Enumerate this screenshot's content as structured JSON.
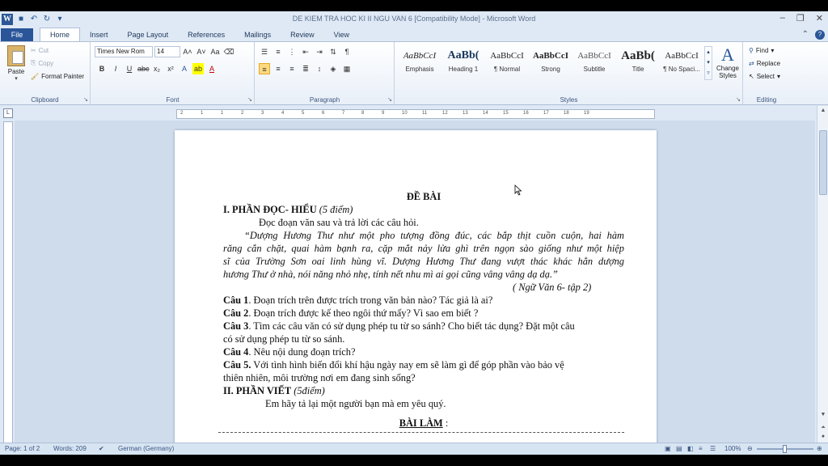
{
  "window": {
    "title": "DE KIEM TRA HOC KI II NGU VAN 6 [Compatibility Mode]  -  Microsoft Word",
    "app_icon": "W"
  },
  "tabs": {
    "file": "File",
    "items": [
      "Home",
      "Insert",
      "Page Layout",
      "References",
      "Mailings",
      "Review",
      "View"
    ]
  },
  "clipboard": {
    "label": "Clipboard",
    "paste": "Paste",
    "cut": "Cut",
    "copy": "Copy",
    "format_painter": "Format Painter"
  },
  "font": {
    "label": "Font",
    "family": "Times New Rom",
    "size": "14"
  },
  "paragraph": {
    "label": "Paragraph"
  },
  "styles": {
    "label": "Styles",
    "items": [
      {
        "sample": "AaBbCcI",
        "name": "Emphasis"
      },
      {
        "sample": "AaBb(",
        "name": "Heading 1"
      },
      {
        "sample": "AaBbCcI",
        "name": "¶ Normal"
      },
      {
        "sample": "AaBbCcI",
        "name": "Strong"
      },
      {
        "sample": "AaBbCcI",
        "name": "Subtitle"
      },
      {
        "sample": "AaBb(",
        "name": "Title"
      },
      {
        "sample": "AaBbCcI",
        "name": "¶ No Spaci..."
      }
    ],
    "change_styles": "Change Styles"
  },
  "editing": {
    "label": "Editing",
    "find": "Find",
    "replace": "Replace",
    "select": "Select"
  },
  "ruler": {
    "numbers": [
      "2",
      "1",
      "1",
      "2",
      "3",
      "4",
      "5",
      "6",
      "7",
      "8",
      "9",
      "10",
      "11",
      "12",
      "13",
      "14",
      "15",
      "16",
      "17",
      "18",
      "19"
    ]
  },
  "document": {
    "title": "ĐỀ BÀI",
    "section1_heading": "I. PHẦN ĐỌC- HIỂU",
    "section1_points": "(5 điểm)",
    "instruction": "Đọc đoạn văn sau và trả lời các câu hỏi.",
    "passage": [
      "“Dượng Hương Thư như một pho tượng đồng đúc, các bắp thịt cuồn cuộn, hai hàm",
      "răng cắn chặt, quai hàm bạnh ra, cặp mắt nảy lửa ghì trên ngọn sào giống như một hiệp",
      "sĩ của Trường Sơn oai linh hùng vĩ. Dượng Hương Thư đang vượt thác khác hẳn dượng",
      "hương Thư ở nhà, nói năng nhỏ nhẹ, tính nết nhu mì ai gọi cũng vâng vâng dạ dạ.”"
    ],
    "source": "( Ngữ Văn 6-  tập 2)",
    "questions": [
      {
        "label": "Câu 1",
        "text": ". Đoạn trích trên được trích trong văn bản nào? Tác giả là ai?"
      },
      {
        "label": "Câu 2",
        "text": ". Đoạn trích được kể theo ngôi thứ mấy? Vì sao em biết ?"
      },
      {
        "label": "Câu 3",
        "text": ". Tìm các câu văn có sử dụng phép tu từ so sánh? Cho biết tác dụng? Đặt một câu",
        "cont": "có sử dụng phép tu từ so sánh."
      },
      {
        "label": "Câu 4",
        "text": ". Nêu nội dung đoạn trích?"
      },
      {
        "label": "Câu 5.",
        "text": " Với tình hình biến đổi khí hậu ngày nay em sẽ làm gì để góp phần vào bảo vệ",
        "cont": "thiên nhiên, môi trường nơi em đang sinh sống?"
      }
    ],
    "section2_heading": "II. PHẦN VIẾT",
    "section2_points": "(5điểm)",
    "prompt": "Em hãy tả lại một người bạn mà em yêu quý.",
    "answer_title": "BÀI LÀM",
    "answer_colon": " :"
  },
  "status": {
    "page": "Page: 1 of 2",
    "words": "Words: 209",
    "language": "German (Germany)",
    "zoom": "100%"
  }
}
